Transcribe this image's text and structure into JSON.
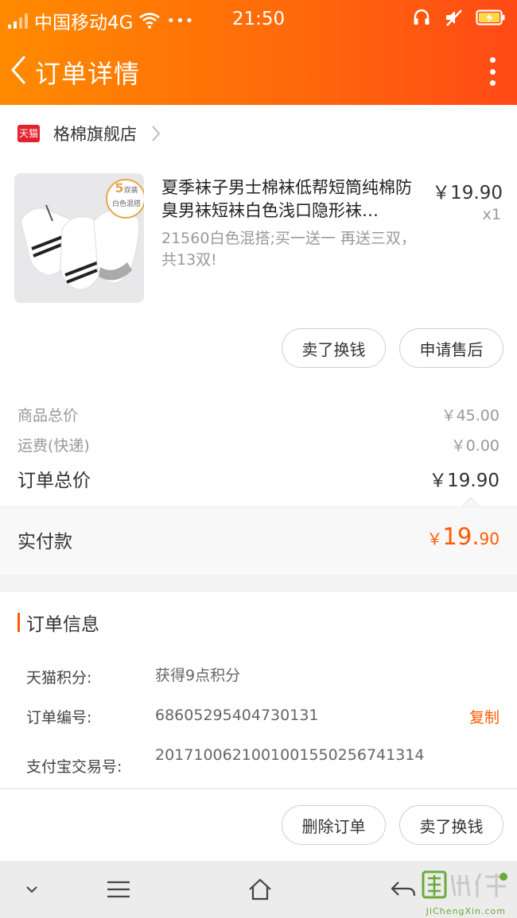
{
  "status": {
    "carrier": "中国移动4G",
    "dots": "•••",
    "time": "21:50"
  },
  "nav": {
    "title": "订单详情"
  },
  "store": {
    "badge": "天猫",
    "name": "格棉旗舰店"
  },
  "product": {
    "title": "夏季袜子男士棉袜低帮短筒纯棉防臭男袜短袜白色浅口隐形袜…",
    "sku": "21560白色混搭;买一送一 再送三双，共13双!",
    "price": "￥19.90",
    "qty": "x1",
    "thumb_tag_num": "5",
    "thumb_tag_unit": "双装",
    "thumb_tag_text": "白色混搭"
  },
  "actions": {
    "sell": "卖了换钱",
    "after_sale": "申请售后",
    "delete": "删除订单",
    "sell2": "卖了换钱"
  },
  "summary": {
    "goods_label": "商品总价",
    "goods_value": "￥45.00",
    "ship_label": "运费(快递)",
    "ship_value": "￥0.00",
    "total_label": "订单总价",
    "total_value": "￥19.90"
  },
  "paid": {
    "label": "实付款",
    "currency": "￥",
    "int": "19.",
    "dec": "90"
  },
  "order_info": {
    "title": "订单信息",
    "rows": [
      {
        "key": "天猫积分:",
        "value": "获得9点积分"
      },
      {
        "key": "订单编号:",
        "value": "68605295404730131",
        "action": "复制"
      },
      {
        "key": "支付宝交易号:",
        "value": "2017100621001001550256741314"
      }
    ]
  },
  "watermark": {
    "text": "JiChengXin.com"
  },
  "colors": {
    "accent": "#ff5a00",
    "header_start": "#ff8a00",
    "header_end": "#ff4a16",
    "tmall_red": "#e4212c"
  }
}
